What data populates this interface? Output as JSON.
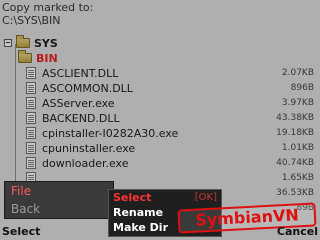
{
  "header": {
    "line1": "Copy marked to:",
    "line2": "C:\\SYS\\BIN"
  },
  "tree": {
    "root": "SYS",
    "folder": "BIN",
    "files": [
      {
        "name": "ASCLIENT.DLL",
        "size": "2.07KB"
      },
      {
        "name": "ASCOMMON.DLL",
        "size": "896B"
      },
      {
        "name": "ASServer.exe",
        "size": "3.97KB"
      },
      {
        "name": "BACKEND.DLL",
        "size": "43.38KB"
      },
      {
        "name": "cpinstaller-I0282A30.exe",
        "size": "19.18KB"
      },
      {
        "name": "cpuninstaller.exe",
        "size": "1.01KB"
      },
      {
        "name": "downloader.exe",
        "size": "40.74KB"
      },
      {
        "name": "",
        "size": "1.65KB"
      },
      {
        "name": "",
        "size": "36.53KB"
      },
      {
        "name": "",
        "size": "89B"
      }
    ]
  },
  "options_menu": {
    "file": "File",
    "back": "Back"
  },
  "submenu": {
    "select": "Select",
    "ok": "[OK]",
    "rename": "Rename",
    "make_dir": "Make Dir"
  },
  "softkeys": {
    "left": "Select",
    "right": "Cancel"
  },
  "watermark": "SymbianVN",
  "colors": {
    "highlight": "#ff3333",
    "menu_bg": "#1f1f1f"
  }
}
